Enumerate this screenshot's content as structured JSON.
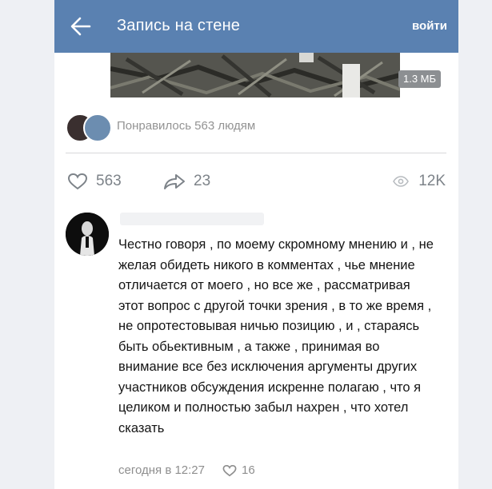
{
  "header": {
    "title": "Запись на стене",
    "login_label": "войти",
    "color": "#5a81b1"
  },
  "media": {
    "size_label": "1.3 МБ"
  },
  "likes_summary": {
    "text": "Понравилось 563 людям"
  },
  "actions": {
    "likes": "563",
    "shares": "23",
    "views": "12K"
  },
  "comment": {
    "text": "Честно говоря , по моему скромному мнению и , не желая обидеть никого в комментах , чье мнение отличается от моего , но все же , рассматривая этот вопрос с другой точки зрения , в то же время , не опротестовывая ничью позицию , и , стараясь быть обьективным , а также , принимая во внимание все без исключения аргументы других участников обсуждения искренне полагаю , что я целиком и полностью забыл нахрен , что хотел сказать",
    "time": "сегодня в 12:27",
    "likes": "16"
  }
}
